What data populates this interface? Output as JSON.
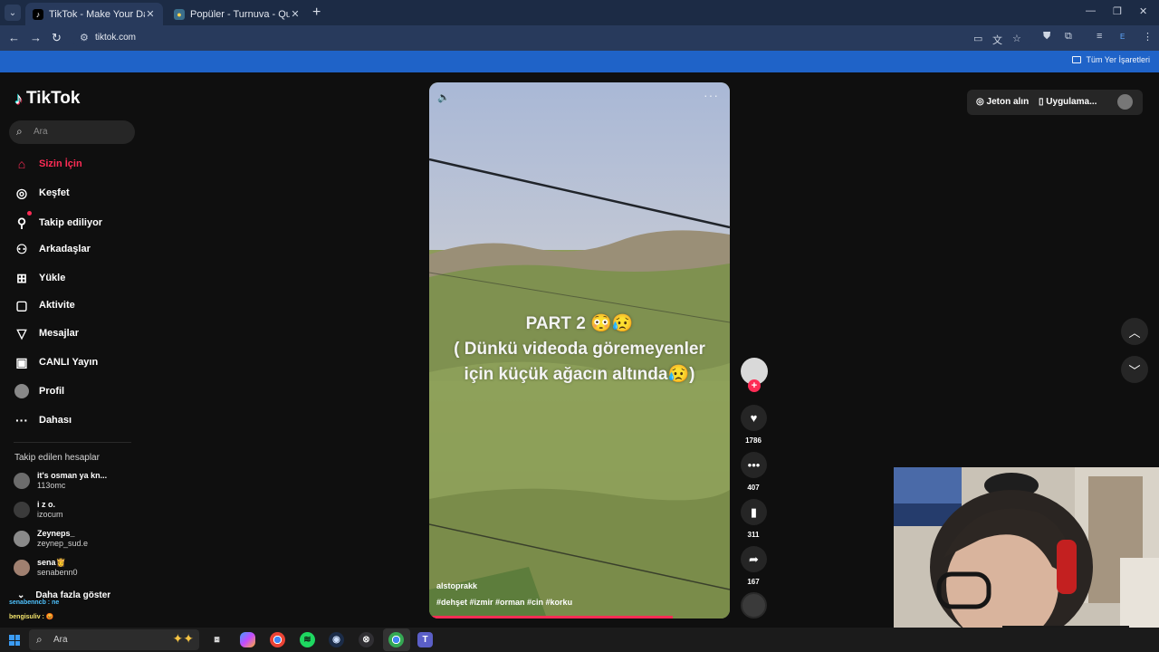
{
  "browser": {
    "tabs": [
      {
        "title": "TikTok - Make Your Day",
        "active": true
      },
      {
        "title": "Popüler - Turnuva - Quizei",
        "active": false
      }
    ],
    "url": "tiktok.com",
    "bookmark_folder": "Tüm Yer İşaretleri",
    "profile_initial": "E"
  },
  "tiktok": {
    "logo": "TikTok",
    "search_placeholder": "Ara",
    "nav": [
      {
        "label": "Sizin İçin",
        "icon": "home-icon"
      },
      {
        "label": "Keşfet",
        "icon": "compass-icon"
      },
      {
        "label": "Takip ediliyor",
        "icon": "following-icon"
      },
      {
        "label": "Arkadaşlar",
        "icon": "friends-icon"
      },
      {
        "label": "Yükle",
        "icon": "upload-icon"
      },
      {
        "label": "Aktivite",
        "icon": "activity-icon"
      },
      {
        "label": "Mesajlar",
        "icon": "messages-icon"
      },
      {
        "label": "CANLI Yayın",
        "icon": "live-icon"
      },
      {
        "label": "Profil",
        "icon": "profile-avatar"
      },
      {
        "label": "Dahası",
        "icon": "more-icon"
      }
    ],
    "following_title": "Takip edilen hesaplar",
    "following": [
      {
        "name": "it's osman ya kn...",
        "user": "113omc"
      },
      {
        "name": "i z o.",
        "user": "izocum"
      },
      {
        "name": "Zeyneps_",
        "user": "zeynep_sud.e"
      },
      {
        "name": "sena👸",
        "user": "senabenn0"
      }
    ],
    "show_more": "Daha fazla göster",
    "chat": [
      {
        "text": "senabenncb : ne"
      },
      {
        "text": "bengisuliv : 😡"
      }
    ],
    "video": {
      "caption_line1": "PART 2 😳😥",
      "caption_line2": "( Dünkü videoda göremeyenler",
      "caption_line3": "için küçük ağacın altında😥)",
      "author": "alstoprakk",
      "tags": "#dehşet #izmir #orman #cin #korku",
      "progress": 0.81
    },
    "actions": {
      "likes": "1786",
      "comments": "407",
      "saves": "311",
      "shares": "167"
    },
    "top_right": {
      "coins": "Jeton alın",
      "app": "Uygulama..."
    }
  },
  "taskbar": {
    "search_placeholder": "Ara"
  }
}
